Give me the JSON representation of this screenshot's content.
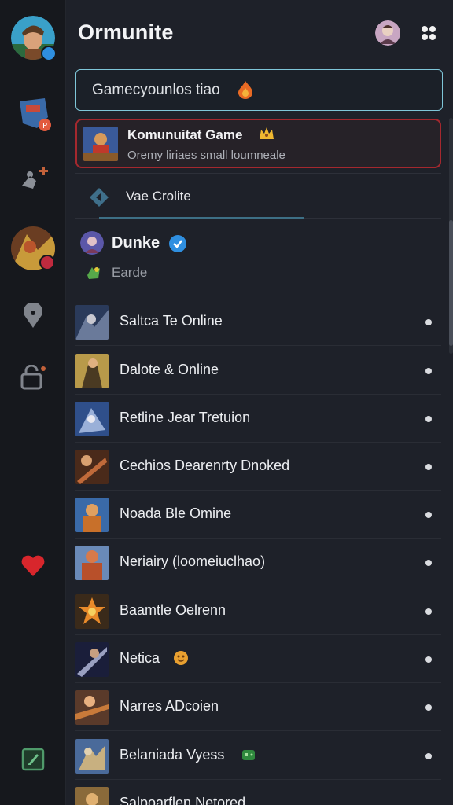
{
  "app": {
    "title": "Ormunite"
  },
  "search": {
    "value": "Gamecyounlos tiao"
  },
  "featured": {
    "title": "Komunuitat Game",
    "subtitle": "Oremy liriaes small loumneale"
  },
  "web_row": {
    "label": "Vae Crolite"
  },
  "profile": {
    "name": "Dunke",
    "status": "Earde"
  },
  "list": [
    {
      "label": "Saltca Te Online"
    },
    {
      "label": "Dalotе & Online"
    },
    {
      "label": "Retline Jear Tretuion"
    },
    {
      "label": "Cechios Dearenrty Dnoked"
    },
    {
      "label": "Noada Ble Omine"
    },
    {
      "label": "Neriairy (loomeiuclhao)"
    },
    {
      "label": "Baamtle Oelrenn"
    },
    {
      "label": "Netica"
    },
    {
      "label": "Narres ADcoien"
    },
    {
      "label": "Belaniada Vyess"
    },
    {
      "label": "Salpoarflen Netored"
    }
  ],
  "colors": {
    "accent": "#2f8fe0",
    "featured_border": "#a4282e",
    "search_border": "#7fc6d8",
    "background": "#1e2129"
  }
}
